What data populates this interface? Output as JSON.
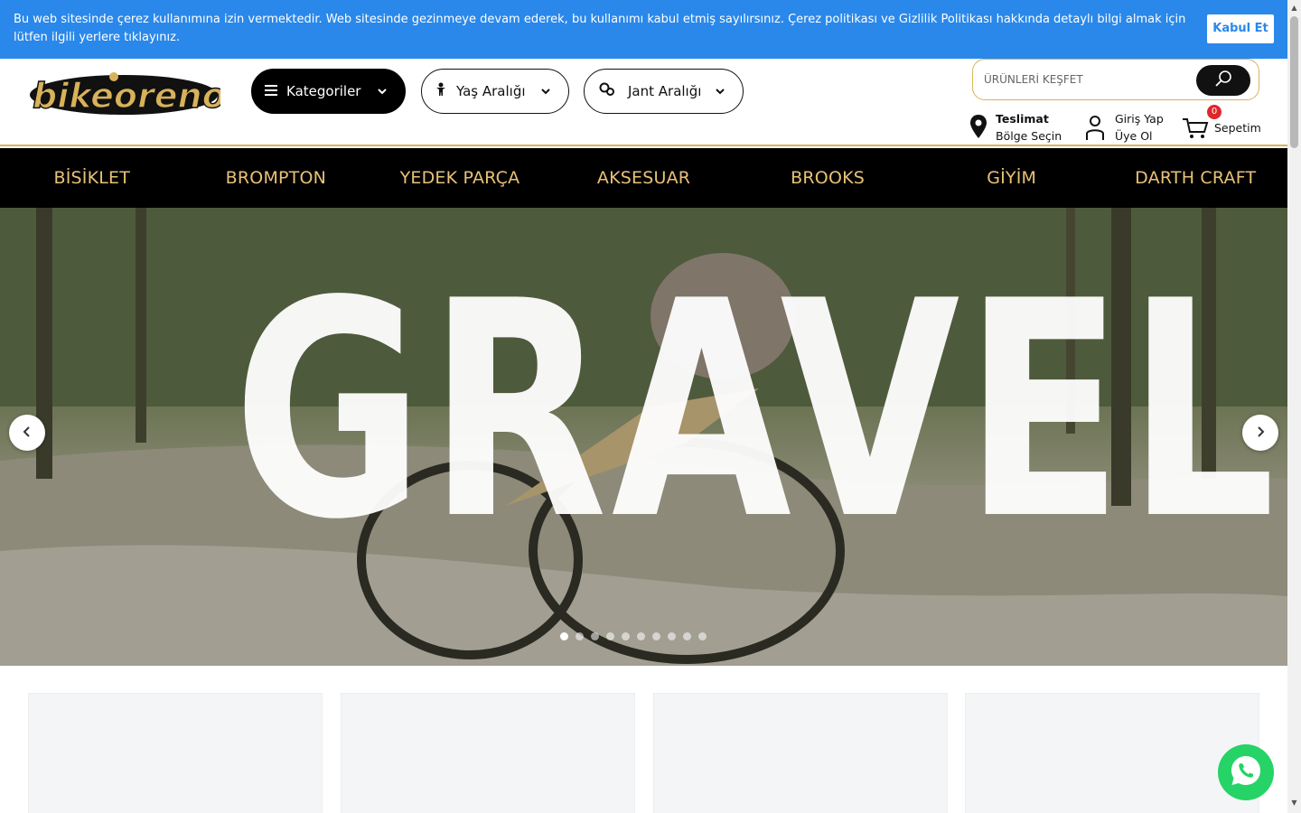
{
  "cookie": {
    "text": "Bu web sitesinde çerez kullanımına izin vermektedir. Web sitesinde gezinmeye devam ederek, bu kullanımı kabul etmiş sayılırsınız. Çerez politikası ve Gizlilik Politikası hakkında detaylı bilgi almak için lütfen ilgili yerlere tıklayınız.",
    "accept_label": "Kabul Et"
  },
  "header": {
    "logo_text": "bikeorenos",
    "categories_label": "Kategoriler",
    "age_label": "Yaş Aralığı",
    "rim_label": "Jant Aralığı",
    "search_placeholder": "ÜRÜNLERİ KEŞFET",
    "delivery_title": "Teslimat",
    "delivery_sub": "Bölge Seçin",
    "login_label": "Giriş Yap",
    "register_label": "Üye Ol",
    "cart_label": "Sepetim",
    "cart_count": "0"
  },
  "nav": {
    "items": [
      "BİSİKLET",
      "BROMPTON",
      "YEDEK PARÇA",
      "AKSESUAR",
      "BROOKS",
      "GİYİM",
      "DARTH CRAFT"
    ]
  },
  "hero": {
    "headline": "GRAVEL",
    "slide_count": 10,
    "active_slide": 1
  },
  "colors": {
    "cookie_bar": "#2a88ea",
    "nav_bg": "#000000",
    "nav_text": "#e8c277",
    "accent_gold": "#d8b25a",
    "whatsapp": "#25d366",
    "badge_red": "#e0262b"
  },
  "icons": {
    "categories": "hamburger-icon",
    "age": "child-icon",
    "rim": "gears-icon",
    "search": "search-icon",
    "delivery": "location-pin-icon",
    "user": "user-icon",
    "cart": "cart-icon",
    "whatsapp": "whatsapp-icon"
  }
}
